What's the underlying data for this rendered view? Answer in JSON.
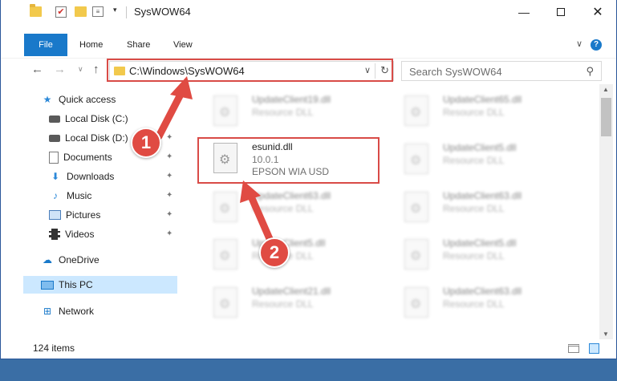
{
  "window": {
    "title": "SysWOW64",
    "check_glyph": "✔",
    "dropdown_glyph": "▾",
    "minimize_glyph": "—",
    "close_glyph": "✕"
  },
  "ribbon": {
    "tabs": [
      {
        "label": "File"
      },
      {
        "label": "Home"
      },
      {
        "label": "Share"
      },
      {
        "label": "View"
      }
    ],
    "collapse_glyph": "∨",
    "help_glyph": "?",
    "accent_color": "#1979ca"
  },
  "nav": {
    "back_glyph": "←",
    "forward_glyph": "→",
    "recent_glyph": "∨",
    "up_glyph": "↑",
    "address_path": "C:\\Windows\\SysWOW64",
    "address_dropdown_glyph": "∨",
    "refresh_glyph": "↻",
    "search_placeholder": "Search SysWOW64",
    "search_glyph": "⚲"
  },
  "sidebar": {
    "pin_glyph": "✦",
    "items": [
      {
        "label": "Quick access",
        "icon": "star-icon",
        "glyph": "★"
      },
      {
        "label": "Local Disk (C:)",
        "icon": "drive-icon"
      },
      {
        "label": "Local Disk (D:)",
        "icon": "drive-icon"
      },
      {
        "label": "Documents",
        "icon": "documents-icon"
      },
      {
        "label": "Downloads",
        "icon": "download-icon",
        "glyph": "⬇"
      },
      {
        "label": "Music",
        "icon": "music-icon",
        "glyph": "♪"
      },
      {
        "label": "Pictures",
        "icon": "pictures-icon"
      },
      {
        "label": "Videos",
        "icon": "videos-icon"
      },
      {
        "label": "OneDrive",
        "icon": "cloud-icon",
        "glyph": "☁"
      },
      {
        "label": "This PC",
        "icon": "computer-icon",
        "selected": true
      },
      {
        "label": "Network",
        "icon": "network-icon",
        "glyph": "⊞"
      }
    ]
  },
  "files": {
    "left": [
      {
        "name": "UpdateClient19.dll",
        "sub": "Resource DLL"
      },
      {
        "name": "esunid.dll",
        "sub": "10.0.1",
        "sub2": "EPSON WIA USD",
        "selected": true
      },
      {
        "name": "UpdateClient63.dll",
        "sub": "Resource DLL"
      },
      {
        "name": "UpdateClient5.dll",
        "sub": "Resource DLL"
      },
      {
        "name": "UpdateClient21.dll",
        "sub": "Resource DLL"
      }
    ],
    "right": [
      {
        "name": "UpdateClient65.dll",
        "sub": "Resource DLL"
      },
      {
        "name": "UpdateClient5.dll",
        "sub": "Resource DLL"
      },
      {
        "name": "UpdateClient63.dll",
        "sub": "Resource DLL"
      },
      {
        "name": "UpdateClient5.dll",
        "sub": "Resource DLL"
      },
      {
        "name": "UpdateClient63.dll",
        "sub": "Resource DLL"
      }
    ]
  },
  "scrollbar": {
    "up_glyph": "▲",
    "down_glyph": "▼"
  },
  "status": {
    "item_count": "124 items"
  },
  "annotations": {
    "step1": "1",
    "step2": "2",
    "color": "#e04b43"
  }
}
